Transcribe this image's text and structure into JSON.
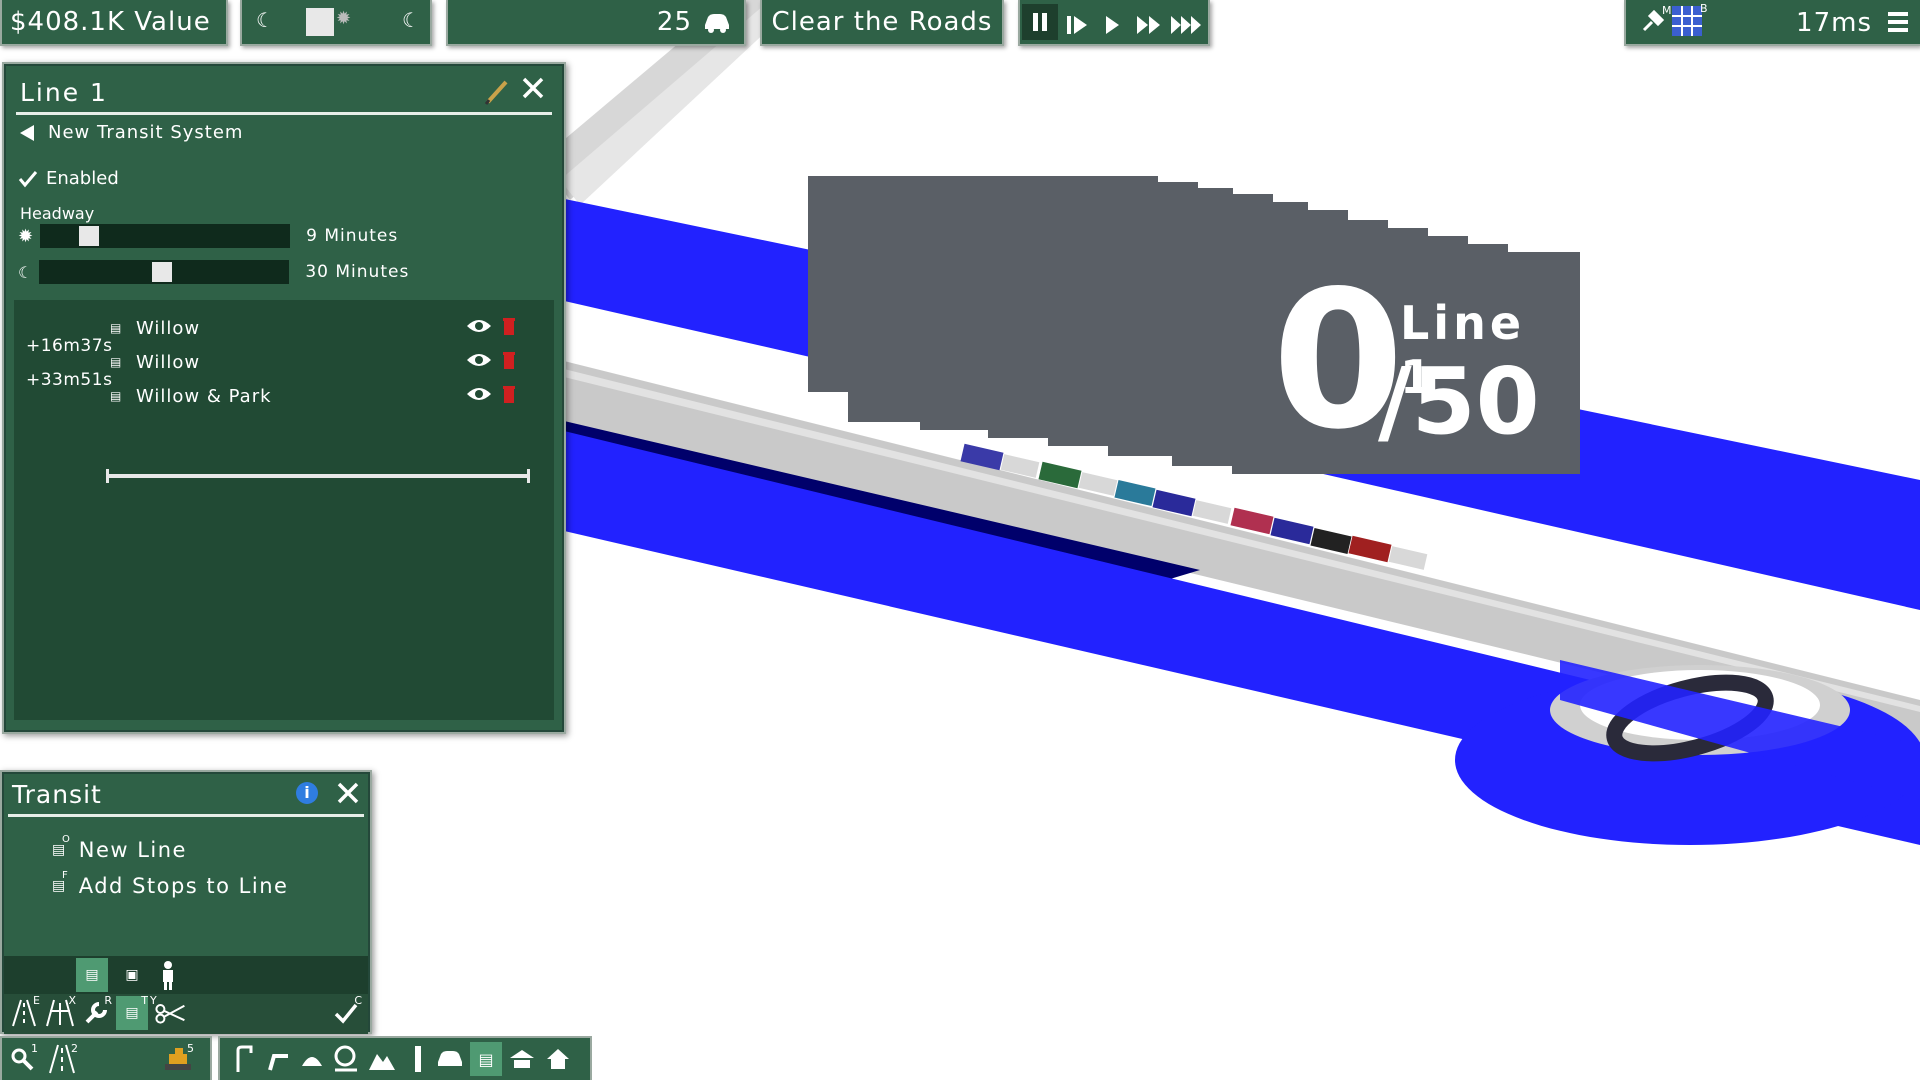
{
  "topbar": {
    "value_text": "$408.1K Value",
    "car_count": "25",
    "clear_roads": "Clear the Roads",
    "frame_time": "17ms"
  },
  "line_panel": {
    "title": "Line 1",
    "back_label": "New Transit System",
    "enabled_label": "Enabled",
    "headway_label": "Headway",
    "day_headway": "9 Minutes",
    "night_headway": "30 Minutes",
    "day_slider_fraction": 0.17,
    "night_slider_fraction": 0.49,
    "time_offsets": [
      "+16m37s",
      "+33m51s"
    ],
    "stops": [
      {
        "name": "Willow"
      },
      {
        "name": "Willow"
      },
      {
        "name": "Willow & Park"
      }
    ]
  },
  "transit_panel": {
    "title": "Transit",
    "items": [
      {
        "label": "New Line",
        "key": "O"
      },
      {
        "label": "Add Stops to Line",
        "key": "F"
      }
    ],
    "tool_keys": [
      "E",
      "X",
      "R",
      "T",
      "Y",
      "C"
    ]
  },
  "bottom_bar": {
    "keys": [
      "1",
      "2",
      "5"
    ]
  },
  "map_label": {
    "line_name": "Line 1",
    "big_number": "0",
    "capacity": "/50"
  },
  "colors": {
    "panel_green": "#2f6147",
    "line_blue": "#2222ff",
    "road_gray": "#c8c8c8",
    "label_gray": "#5a5f66"
  }
}
